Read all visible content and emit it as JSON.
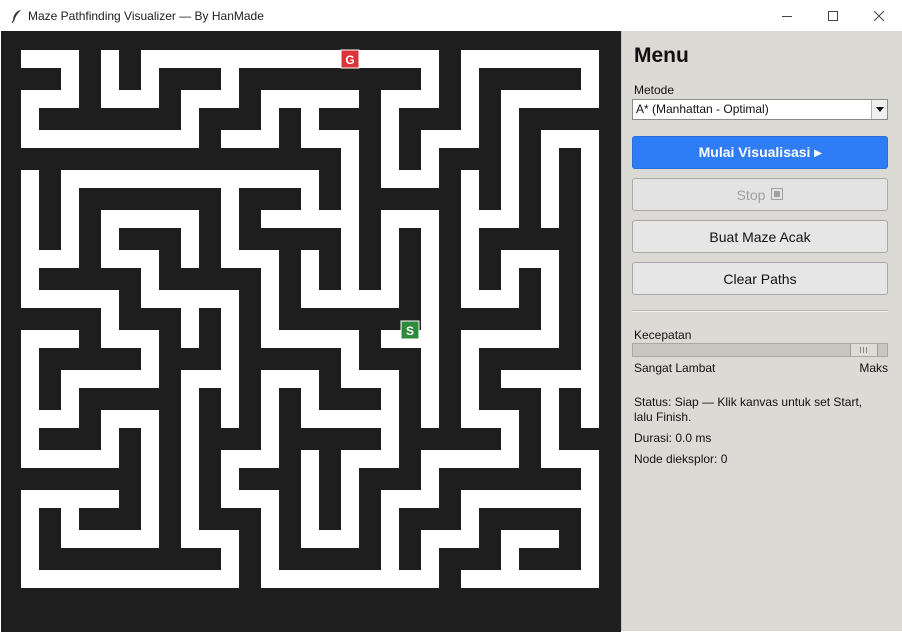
{
  "window": {
    "title": "Maze Pathfinding Visualizer — By HanMade",
    "app_icon": "feather-icon",
    "controls": [
      "minimize-icon",
      "maximize-icon",
      "close-icon"
    ]
  },
  "maze": {
    "background_color": "#1e1e1e",
    "path_color": "#ffffff",
    "start": {
      "label": "S",
      "color": "#2e8b3e"
    },
    "goal": {
      "label": "G",
      "color": "#d9353a"
    }
  },
  "panel": {
    "title": "Menu",
    "method_label": "Metode",
    "method_value": "A* (Manhattan - Optimal)",
    "buttons": {
      "start": "Mulai Visualisasi ▸",
      "stop": "Stop",
      "random_maze": "Buat Maze Acak",
      "clear_paths": "Clear Paths"
    },
    "speed_label": "Kecepatan",
    "speed_min_label": "Sangat Lambat",
    "speed_max_label": "Maks",
    "speed_value_fraction": 0.96,
    "status": "Status: Siap — Klik kanvas untuk set Start, lalu Finish.",
    "duration": "Durasi: 0.0 ms",
    "nodes": "Node dieksplor: 0"
  },
  "colors": {
    "accent": "#2f7df6",
    "panel_bg": "#dcdad5"
  }
}
